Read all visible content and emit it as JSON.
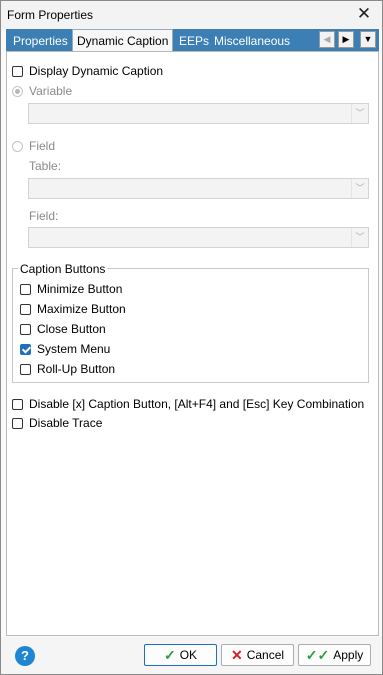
{
  "window": {
    "title": "Form Properties"
  },
  "tabs": [
    {
      "label": "Properties"
    },
    {
      "label": "Dynamic Caption"
    },
    {
      "label": "EEPs"
    },
    {
      "label": "Miscellaneous"
    }
  ],
  "dynamic_caption": {
    "display_label": "Display Dynamic Caption",
    "display_checked": false,
    "variable_label": "Variable",
    "variable_value": "",
    "field_label": "Field",
    "table_label": "Table:",
    "table_value": "",
    "field_sub_label": "Field:",
    "field_value": ""
  },
  "caption_buttons": {
    "group_label": "Caption Buttons",
    "items": [
      {
        "label": "Minimize Button",
        "checked": false
      },
      {
        "label": "Maximize Button",
        "checked": false
      },
      {
        "label": "Close Button",
        "checked": false
      },
      {
        "label": "System Menu",
        "checked": true
      },
      {
        "label": "Roll-Up Button",
        "checked": false
      }
    ]
  },
  "options": {
    "disable_x_label": "Disable [x] Caption Button, [Alt+F4] and [Esc] Key Combination",
    "disable_trace_label": "Disable Trace"
  },
  "footer": {
    "help_glyph": "?",
    "ok_label": "OK",
    "cancel_label": "Cancel",
    "apply_label": "Apply"
  },
  "colors": {
    "tab_strip": "#3c7fb5",
    "check_accent": "#1f6fbf",
    "help_icon": "#1e86d3",
    "ok_check": "#2e9e3e",
    "cancel_x": "#d21f26"
  }
}
